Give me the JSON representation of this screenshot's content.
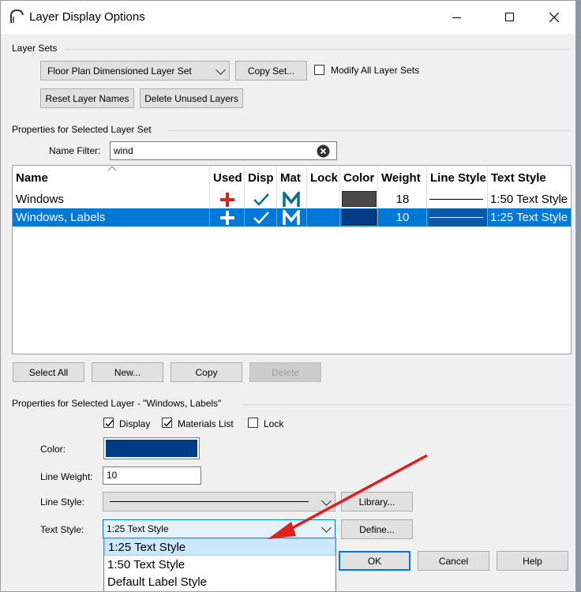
{
  "window": {
    "title": "Layer Display Options"
  },
  "layer_sets": {
    "group_label": "Layer Sets",
    "selected_set": "Floor Plan Dimensioned Layer Set",
    "copy_set_label": "Copy Set...",
    "modify_all_label": "Modify All Layer Sets",
    "modify_all_checked": false,
    "reset_label": "Reset Layer Names",
    "delete_unused_label": "Delete Unused Layers"
  },
  "set_props": {
    "group_label": "Properties for Selected Layer Set",
    "name_filter_label": "Name Filter:",
    "name_filter_value": "wind"
  },
  "table": {
    "columns": [
      "Name",
      "Used",
      "Disp",
      "Mat",
      "Lock",
      "Color",
      "Weight",
      "Line Style",
      "Text Style"
    ],
    "rows": [
      {
        "name": "Windows",
        "weight": "18",
        "text_style": "1:50 Text Style",
        "color": "#4a4a4a",
        "selected": false
      },
      {
        "name": "Windows, Labels",
        "weight": "10",
        "text_style": "1:25 Text Style",
        "color": "#003b85",
        "selected": true
      }
    ]
  },
  "list_buttons": {
    "select_all": "Select All",
    "new": "New...",
    "copy": "Copy",
    "delete": "Delete"
  },
  "layer_props": {
    "group_label": "Properties for Selected Layer - \"Windows, Labels\"",
    "display_label": "Display",
    "materials_label": "Materials List",
    "lock_label": "Lock",
    "color_label": "Color:",
    "color_value": "#003b85",
    "line_weight_label": "Line Weight:",
    "line_weight_value": "10",
    "line_style_label": "Line Style:",
    "library_label": "Library...",
    "text_style_label": "Text Style:",
    "text_style_value": "1:25 Text Style",
    "define_label": "Define..."
  },
  "dropdown_options": [
    "1:25 Text Style",
    "1:50 Text Style",
    "Default Label Style"
  ],
  "dialog_buttons": {
    "ok": "OK",
    "cancel": "Cancel",
    "help": "Help"
  },
  "colors": {
    "accent": "#0078d7",
    "used_red": "#cc2a1c",
    "check_teal": "#0b6e8a",
    "arrow_red": "#e02020"
  }
}
